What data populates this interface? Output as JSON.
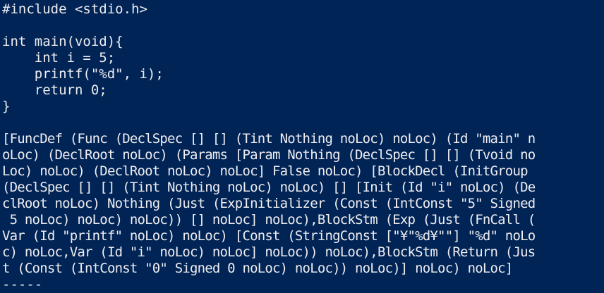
{
  "window": {
    "background_color": "#012456",
    "text_color": "#eeedf0"
  },
  "source_code": [
    "#include <stdio.h>",
    "",
    "int main(void){",
    "    int i = 5;",
    "    printf(\"%d\", i);",
    "    return 0;",
    "}"
  ],
  "ast_output": [
    "[FuncDef (Func (DeclSpec [] [] (Tint Nothing noLoc) noLoc) (Id \"main\" n",
    "oLoc) (DeclRoot noLoc) (Params [Param Nothing (DeclSpec [] [] (Tvoid no",
    "Loc) noLoc) (DeclRoot noLoc) noLoc] False noLoc) [BlockDecl (InitGroup",
    "(DeclSpec [] [] (Tint Nothing noLoc) noLoc) [] [Init (Id \"i\" noLoc) (De",
    "clRoot noLoc) Nothing (Just (ExpInitializer (Const (IntConst \"5\" Signed",
    " 5 noLoc) noLoc) noLoc)) [] noLoc] noLoc),BlockStm (Exp (Just (FnCall (",
    "Var (Id \"printf\" noLoc) noLoc) [Const (StringConst [\"¥\"%d¥\"\"] \"%d\" noLo",
    "c) noLoc,Var (Id \"i\" noLoc) noLoc] noLoc)) noLoc),BlockStm (Return (Jus",
    "t (Const (IntConst \"0\" Signed 0 noLoc) noLoc)) noLoc)] noLoc) noLoc]"
  ],
  "separator": "-----"
}
